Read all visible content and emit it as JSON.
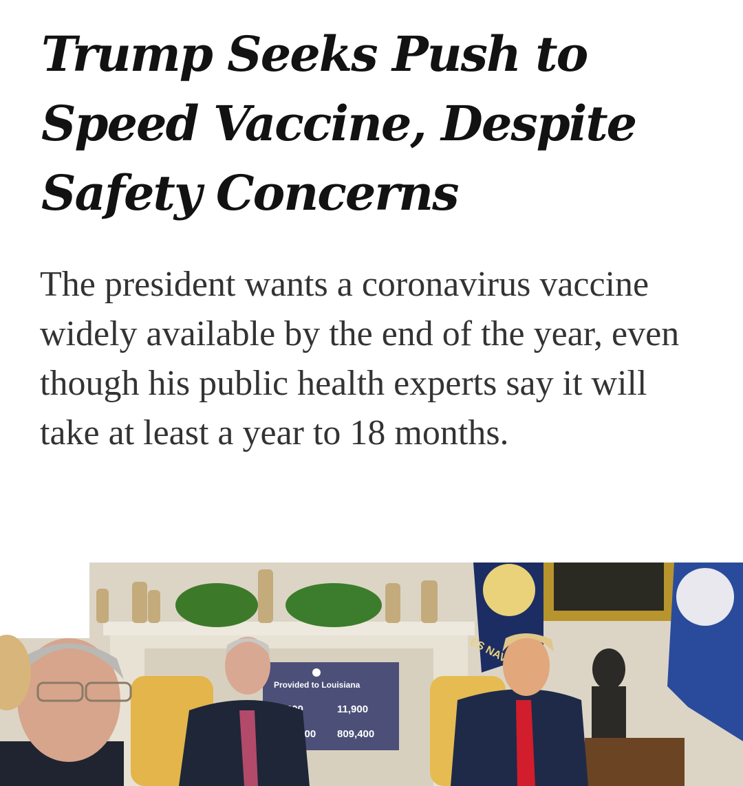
{
  "article": {
    "headline": "Trump Seeks Push to Speed Vaccine, Despite Safety Concerns",
    "summary": "The president wants a coronavirus vaccine widely available by the end of the year, even though his public health experts say it will take at least a year to 18 months."
  },
  "photo": {
    "sign_title": "Provided to Louisiana",
    "sign_values": [
      "01,300",
      "11,900",
      ",000",
      "809,400"
    ],
    "flag_text": "ES NAV"
  },
  "colors": {
    "headline": "#121212",
    "summary": "#333333",
    "sign_bg": "#4c4f78"
  }
}
